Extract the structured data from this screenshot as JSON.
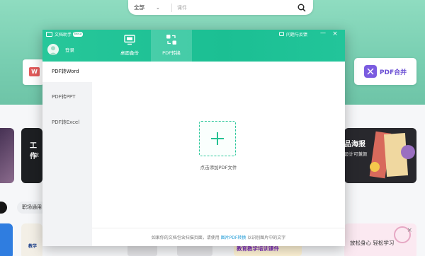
{
  "background_page": {
    "search": {
      "scope_selected": "全部",
      "placeholder": "课件"
    },
    "side_card_letter": "W",
    "merge_card_label": "PDF合并",
    "templates": {
      "card_b_title": "工作",
      "card_b_subtitle": "高效",
      "card_c_title": "品海报",
      "card_c_subtitle": "设计可兼颜",
      "chip_label": "职场通用",
      "card_e_text": "教学",
      "card_f_text": "放松身心 轻松学习",
      "card_g_text": "教育教学培训课件"
    }
  },
  "dialog": {
    "brand_name": "文档助手",
    "brand_tag": "Beta",
    "login_label": "登录",
    "tabs": [
      {
        "label": "桌面备份"
      },
      {
        "label": "PDF转换"
      }
    ],
    "help_label": "问题与反馈",
    "sidebar": [
      {
        "label": "PDF转Word"
      },
      {
        "label": "PDF转PPT"
      },
      {
        "label": "PDF转Excel"
      }
    ],
    "drop_label": "点击添加PDF文件",
    "footer": {
      "prefix": "如果你的文档包含扫描页面，请使用 ",
      "link": "图片PDF转换",
      "suffix": " 以识别图片中的文字"
    },
    "active_tab_index": 1,
    "active_sidebar_index": 0
  },
  "colors": {
    "accent": "#1bbf93",
    "link": "#1c9ad6",
    "merge": "#6b4fd4"
  }
}
